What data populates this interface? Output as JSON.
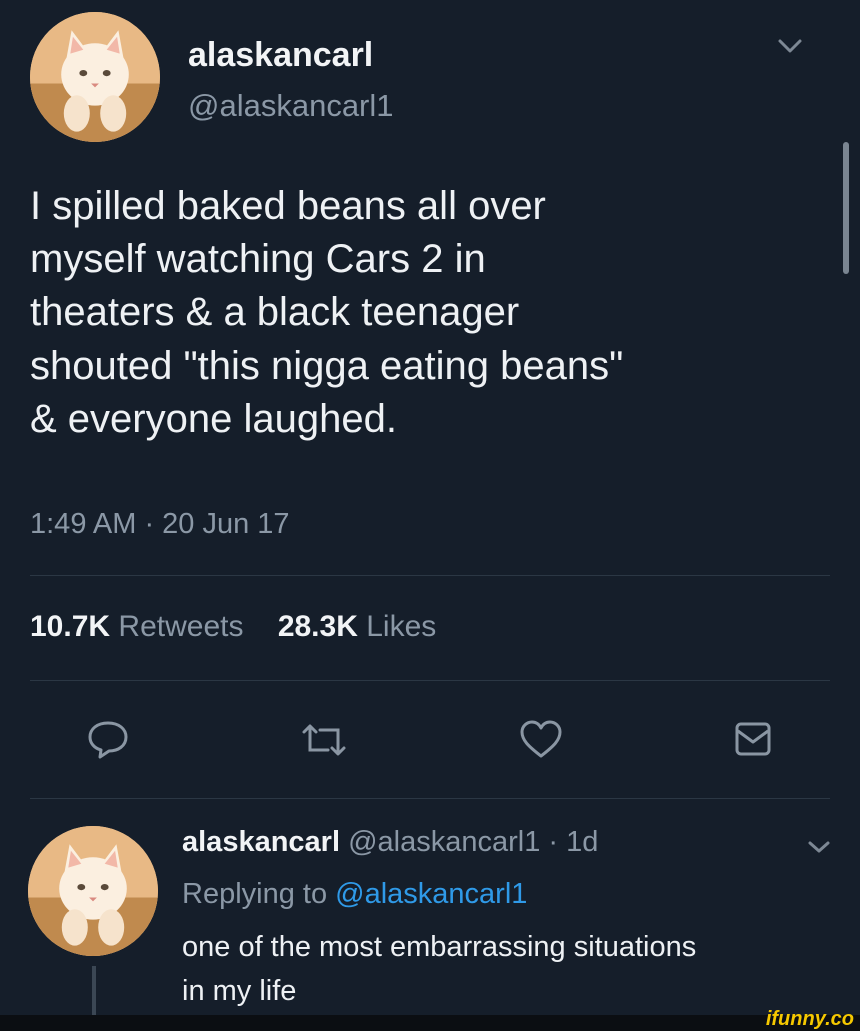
{
  "tweet": {
    "display_name": "alaskancarl",
    "handle": "@alaskancarl1",
    "text_lines": [
      "I spilled baked beans all over",
      "myself watching Cars 2 in",
      "theaters & a black teenager",
      "shouted \"this nigga eating beans\"",
      "& everyone laughed."
    ],
    "timestamp": "1:49 AM · 20 Jun 17",
    "retweets_count": "10.7K",
    "retweets_label": "Retweets",
    "likes_count": "28.3K",
    "likes_label": "Likes"
  },
  "actions": {
    "reply_icon": "reply-icon",
    "retweet_icon": "retweet-icon",
    "like_icon": "heart-icon",
    "share_icon": "envelope-icon"
  },
  "reply": {
    "display_name": "alaskancarl",
    "handle": "@alaskancarl1",
    "age": "· 1d",
    "replying_prefix": "Replying to",
    "replying_to": "@alaskancarl1",
    "text_lines": [
      "one of the most embarrassing situations",
      "in my life"
    ]
  },
  "watermark": "ifunny.co",
  "colors": {
    "background": "#151e2a",
    "text": "#eef1f4",
    "muted": "#8b98a6",
    "link": "#2f9ae8",
    "watermark": "#f5c800"
  }
}
